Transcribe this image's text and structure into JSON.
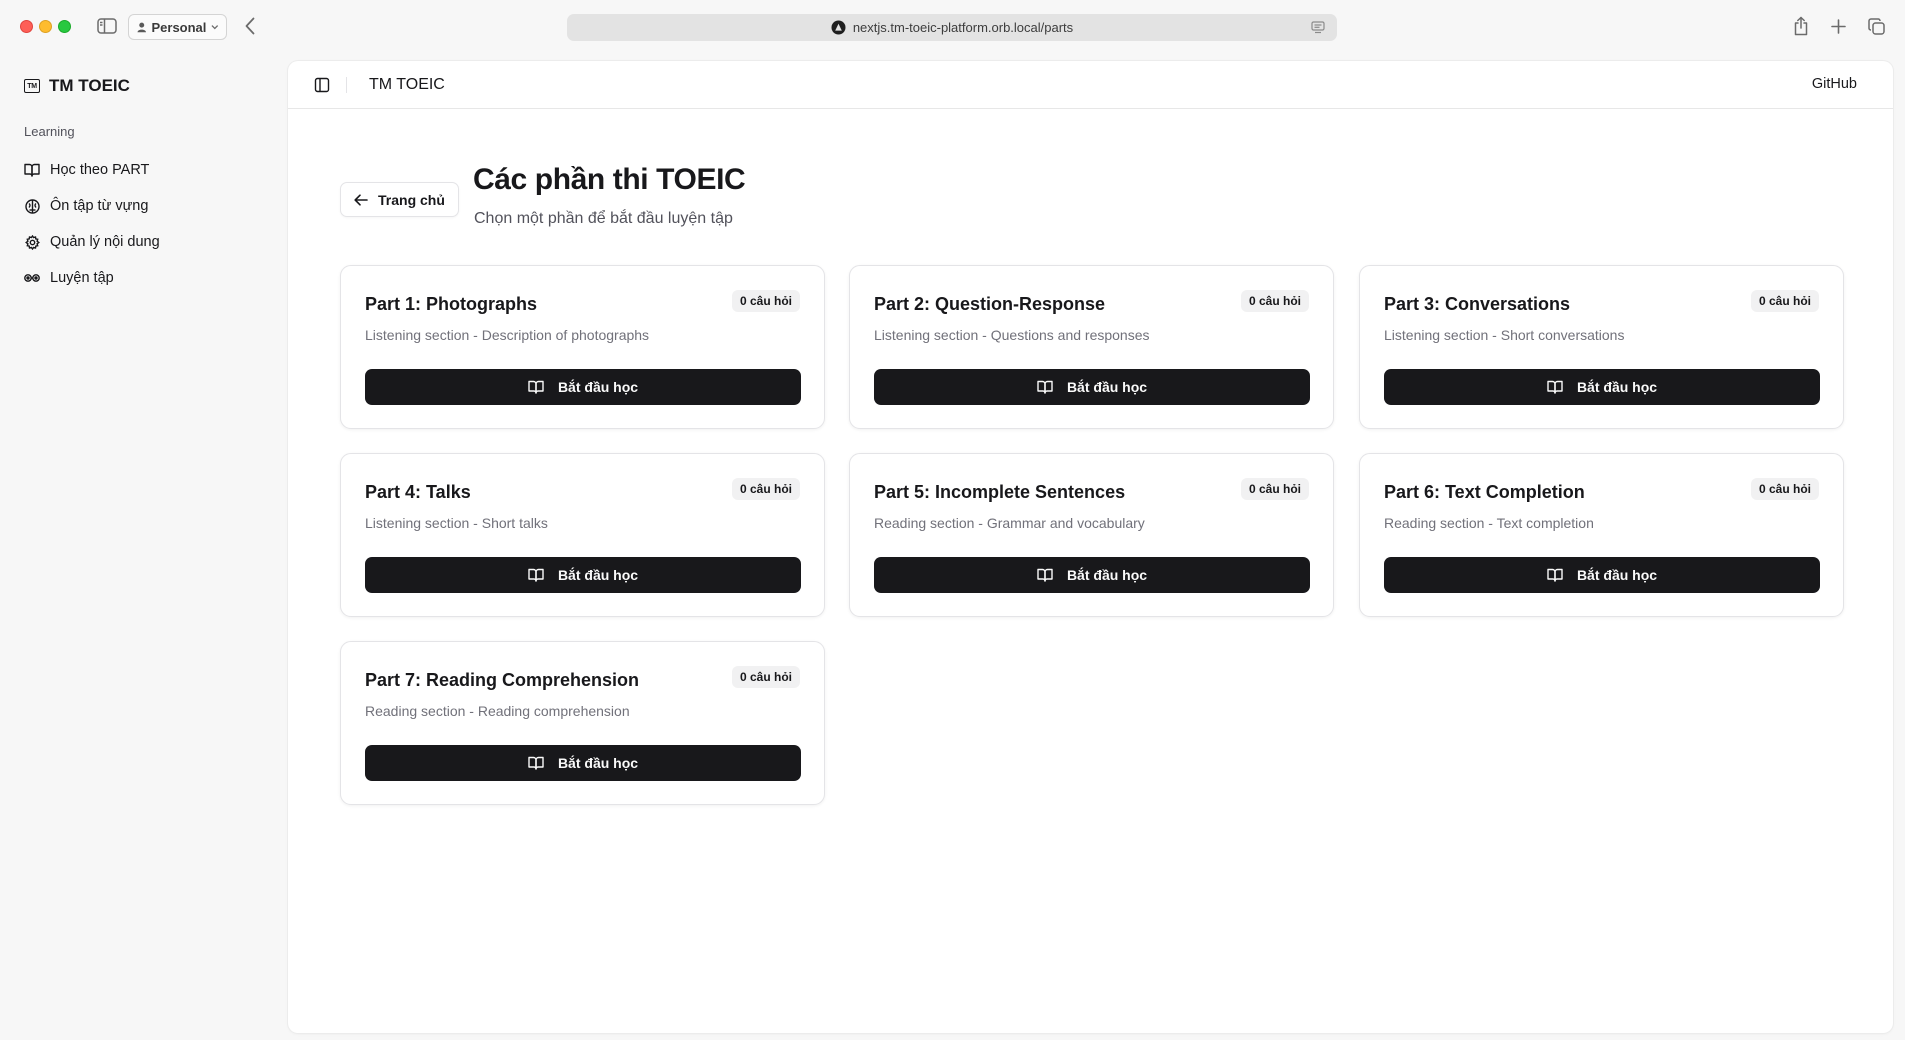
{
  "browser": {
    "profile_label": "Personal",
    "url": "nextjs.tm-toeic-platform.orb.local/parts"
  },
  "sidebar": {
    "brand_logo_text": "TM",
    "brand_name": "TM TOEIC",
    "group_label": "Learning",
    "items": [
      {
        "label": "Học theo PART",
        "icon": "book-open-icon"
      },
      {
        "label": "Ôn tập từ vựng",
        "icon": "brain-icon"
      },
      {
        "label": "Quản lý nội dung",
        "icon": "settings-icon"
      },
      {
        "label": "Luyện tập",
        "icon": "dumbbell-icon"
      }
    ]
  },
  "header": {
    "title": "TM TOEIC",
    "github_label": "GitHub"
  },
  "page": {
    "back_label": "Trang chủ",
    "title": "Các phần thi TOEIC",
    "subtitle": "Chọn một phần để bắt đầu luyện tập"
  },
  "parts": [
    {
      "title": "Part 1: Photographs",
      "description": "Listening section - Description of photographs",
      "badge": "0 câu hỏi",
      "button_label": "Bắt đầu học"
    },
    {
      "title": "Part 2: Question-Response",
      "description": "Listening section - Questions and responses",
      "badge": "0 câu hỏi",
      "button_label": "Bắt đầu học"
    },
    {
      "title": "Part 3: Conversations",
      "description": "Listening section - Short conversations",
      "badge": "0 câu hỏi",
      "button_label": "Bắt đầu học"
    },
    {
      "title": "Part 4: Talks",
      "description": "Listening section - Short talks",
      "badge": "0 câu hỏi",
      "button_label": "Bắt đầu học"
    },
    {
      "title": "Part 5: Incomplete Sentences",
      "description": "Reading section - Grammar and vocabulary",
      "badge": "0 câu hỏi",
      "button_label": "Bắt đầu học"
    },
    {
      "title": "Part 6: Text Completion",
      "description": "Reading section - Text completion",
      "badge": "0 câu hỏi",
      "button_label": "Bắt đầu học"
    },
    {
      "title": "Part 7: Reading Comprehension",
      "description": "Reading section - Reading comprehension",
      "badge": "0 câu hỏi",
      "button_label": "Bắt đầu học"
    }
  ],
  "colors": {
    "primary": "#18181b",
    "muted_text": "#71717a",
    "border": "#e4e4e7",
    "badge_bg": "#f1f1f2",
    "app_bg": "#f7f7f7"
  }
}
